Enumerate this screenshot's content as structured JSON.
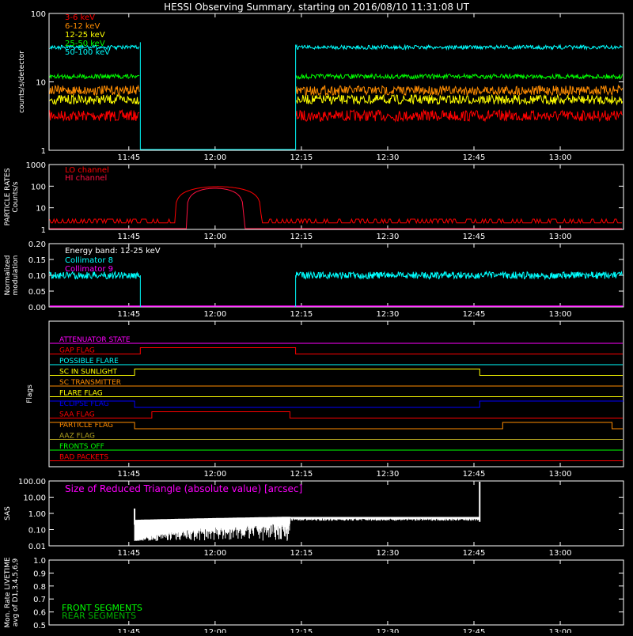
{
  "title": "HESSI Observing Summary, starting on 2016/08/10 11:31:08 UT",
  "time_ticks": [
    "11:45",
    "12:00",
    "12:15",
    "12:30",
    "12:45",
    "13:00"
  ],
  "colors": {
    "white": "#ffffff",
    "red": "#ff0000",
    "orange": "#ff8c00",
    "yellow": "#ffff00",
    "green": "#00ff00",
    "cyan": "#00ffff",
    "magenta": "#ff00ff",
    "blue": "#0000ff",
    "olive": "#b0a020",
    "darkgreen": "#00b000",
    "crimson": "#ff1040"
  },
  "chart_data": [
    {
      "id": "counts",
      "type": "line",
      "ylabel": "counts/s/detector",
      "yscale": "log",
      "ylim": [
        1,
        100
      ],
      "yticks": [
        "1",
        "10",
        "100"
      ],
      "xlim": [
        "11:31:08",
        "13:11"
      ],
      "gap": [
        "11:47",
        "12:14"
      ],
      "series": [
        {
          "name": "3-6 keV",
          "color": "#ff0000",
          "level": 3.2
        },
        {
          "name": "6-12 keV",
          "color": "#ff8c00",
          "level": 7.5
        },
        {
          "name": "12-25 keV",
          "color": "#ffff00",
          "level": 5.5
        },
        {
          "name": "25-50 keV",
          "color": "#00ff00",
          "level": 12
        },
        {
          "name": "50-100 keV",
          "color": "#00ffff",
          "level": 32
        }
      ]
    },
    {
      "id": "particle",
      "type": "line",
      "ylabel": "PARTICLE RATES Counts/s",
      "yscale": "log",
      "ylim": [
        1,
        1000
      ],
      "yticks": [
        "1",
        "10",
        "100",
        "1000"
      ],
      "series": [
        {
          "name": "LO channel",
          "color": "#ff0000",
          "base": 2,
          "peak": 95,
          "start": "11:53",
          "end": "12:08"
        },
        {
          "name": "HI channel",
          "color": "#ff1040",
          "base": 1,
          "peak": 80,
          "start": "11:55",
          "end": "12:05"
        }
      ]
    },
    {
      "id": "modulation",
      "type": "line",
      "ylabel": "Normalized modulation",
      "ylim": [
        0,
        0.2
      ],
      "yticks": [
        "0.00",
        "0.05",
        "0.10",
        "0.15",
        "0.20"
      ],
      "annotation": "Energy band: 12-25 keV",
      "series": [
        {
          "name": "Collimator 8",
          "color": "#00ffff",
          "level": 0.1
        },
        {
          "name": "Collimator 9",
          "color": "#ff00ff",
          "level": 0.0
        }
      ]
    },
    {
      "id": "flags",
      "type": "line",
      "ylabel": "Flags",
      "series": [
        {
          "name": "ATTENUATOR STATE",
          "color": "#ff00ff",
          "high": []
        },
        {
          "name": "GAP FLAG",
          "color": "#ff0000",
          "high": [
            [
              "11:47",
              "12:14"
            ]
          ]
        },
        {
          "name": "POSSIBLE FLARE",
          "color": "#00ffff",
          "high": []
        },
        {
          "name": "SC IN SUNLIGHT",
          "color": "#ffff00",
          "high": [
            [
              "11:46",
              "12:46"
            ]
          ]
        },
        {
          "name": "SC TRANSMITTER",
          "color": "#ff8c00",
          "high": []
        },
        {
          "name": "FLARE FLAG",
          "color": "#ffff00",
          "high": []
        },
        {
          "name": "ECLIPSE FLAG",
          "color": "#0000ff",
          "high": [
            [
              "11:31:08",
              "11:46"
            ],
            [
              "12:46",
              "13:11"
            ]
          ]
        },
        {
          "name": "SAA FLAG",
          "color": "#ff0000",
          "high": [
            [
              "11:49",
              "12:13"
            ]
          ]
        },
        {
          "name": "PARTICLE FLAG",
          "color": "#ff8c00",
          "high": [
            [
              "11:31:08",
              "11:46"
            ],
            [
              "12:50",
              "13:09"
            ]
          ]
        },
        {
          "name": "AAZ FLAG",
          "color": "#b0a020",
          "high": []
        },
        {
          "name": "FRONTS OFF",
          "color": "#00ff00",
          "high": []
        },
        {
          "name": "BAD PACKETS",
          "color": "#ff0000",
          "high": []
        }
      ]
    },
    {
      "id": "sas",
      "type": "line",
      "ylabel": "SAS",
      "yscale": "log",
      "ylim": [
        0.01,
        100
      ],
      "yticks": [
        "0.01",
        "0.10",
        "1.00",
        "10.00",
        "100.00"
      ],
      "annotation": "Size of Reduced Triangle (absolute value) [arcsec]",
      "series": [
        {
          "color": "#ffffff",
          "start": "11:46",
          "end": "12:46"
        }
      ]
    },
    {
      "id": "livetime",
      "type": "line",
      "ylabel": "Mon. Rate LIVETIME avg of D1,3,4,5,6,9",
      "ylim": [
        0.5,
        1.0
      ],
      "yticks": [
        "0.5",
        "0.6",
        "0.7",
        "0.8",
        "0.9",
        "1.0"
      ],
      "series": [
        {
          "name": "FRONT SEGMENTS",
          "color": "#00ff00"
        },
        {
          "name": "REAR SEGMENTS",
          "color": "#00b000"
        }
      ]
    }
  ]
}
